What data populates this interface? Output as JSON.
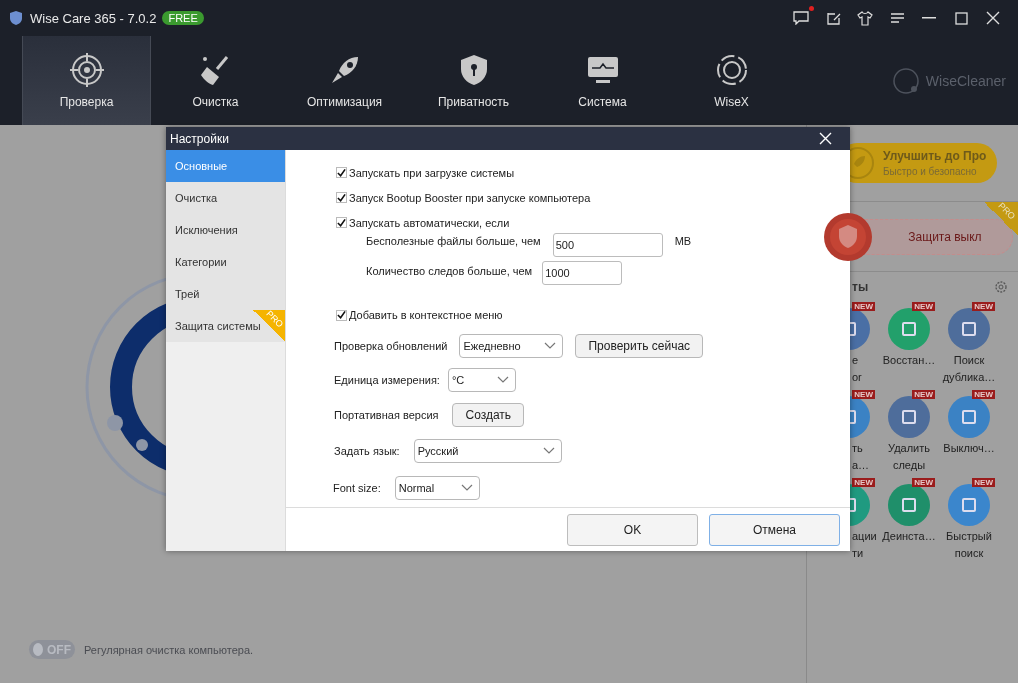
{
  "app": {
    "title": "Wise Care 365 - 7.0.2",
    "badge": "FREE",
    "unread": true
  },
  "nav": [
    {
      "label": "Проверка",
      "selected": true
    },
    {
      "label": "Очистка",
      "selected": false
    },
    {
      "label": "Оптимизация",
      "selected": false
    },
    {
      "label": "Приватность",
      "selected": false
    },
    {
      "label": "Система",
      "selected": false
    },
    {
      "label": "WiseX",
      "selected": false
    }
  ],
  "brand": "WiseCleaner",
  "schedule": {
    "toggle": "OFF",
    "on": false,
    "label": "Регулярная очистка компьютера."
  },
  "right_panel": {
    "upgrade": {
      "title": "Улучшить до Про",
      "subtitle": "Быстро и безопасно"
    },
    "protection": {
      "label": "Защита выкл",
      "badge": "PRO"
    },
    "tools_heading": "ты",
    "tools": [
      {
        "lines": [
          "e",
          "or"
        ],
        "badge": "NEW",
        "cut": true,
        "color": "#4a6fa5"
      },
      {
        "lines": [
          "Восстан…"
        ],
        "badge": "NEW",
        "cut": false,
        "color": "#22a06b"
      },
      {
        "lines": [
          "Поиск",
          "дублика…"
        ],
        "badge": "NEW",
        "cut": false,
        "color": "#4e6d9b"
      },
      {
        "lines": [
          "ть",
          "а…"
        ],
        "badge": "NEW",
        "cut": true,
        "color": "#3b82c4"
      },
      {
        "lines": [
          "Удалить",
          "следы"
        ],
        "badge": "NEW",
        "cut": false,
        "color": "#4e6d9b"
      },
      {
        "lines": [
          "Выключ…"
        ],
        "badge": "NEW",
        "cut": false,
        "color": "#3b82c4"
      },
      {
        "lines": [
          "ации",
          "ти"
        ],
        "badge": "NEW",
        "cut": true,
        "color": "#1f9a80"
      },
      {
        "lines": [
          "Деинста…"
        ],
        "badge": "NEW",
        "cut": false,
        "color": "#1f8f6a"
      },
      {
        "lines": [
          "Быстрый",
          "поиск"
        ],
        "badge": "NEW",
        "cut": false,
        "color": "#3b86cc"
      }
    ]
  },
  "dialog": {
    "title": "Настройки",
    "sidebar": [
      {
        "label": "Основные",
        "selected": true
      },
      {
        "label": "Очистка",
        "selected": false
      },
      {
        "label": "Исключения",
        "selected": false
      },
      {
        "label": "Категории",
        "selected": false
      },
      {
        "label": "Трей",
        "selected": false
      },
      {
        "label": "Защита системы",
        "selected": false,
        "badge": "PRO"
      }
    ],
    "startup": [
      {
        "label": "Запускать при загрузке системы",
        "checked": true
      },
      {
        "label": "Запуск Bootup Booster при запуске компьютера",
        "checked": true
      },
      {
        "label": "Запускать автоматически, если",
        "checked": true
      }
    ],
    "thresholds": [
      {
        "label": "Бесполезные файлы больше, чем",
        "value": "500",
        "unit": "MB"
      },
      {
        "label": "Количество следов больше, чем",
        "value": "1000"
      }
    ],
    "context_menu": {
      "label": "Добавить в контекстное меню",
      "checked": true
    },
    "update": {
      "label": "Проверка обновлений",
      "value": "Ежедневно",
      "button": "Проверить сейчас"
    },
    "unit": {
      "label": "Единица измерения:",
      "value": "°C"
    },
    "portable": {
      "label": "Портативная версия",
      "button": "Создать"
    },
    "language": {
      "label": "Задать язык:",
      "value": "Русский"
    },
    "font_size": {
      "label": "Font size:",
      "value": "Normal"
    },
    "buttons": [
      {
        "label": "OK",
        "focused": false
      },
      {
        "label": "Отмена",
        "focused": true
      }
    ]
  }
}
